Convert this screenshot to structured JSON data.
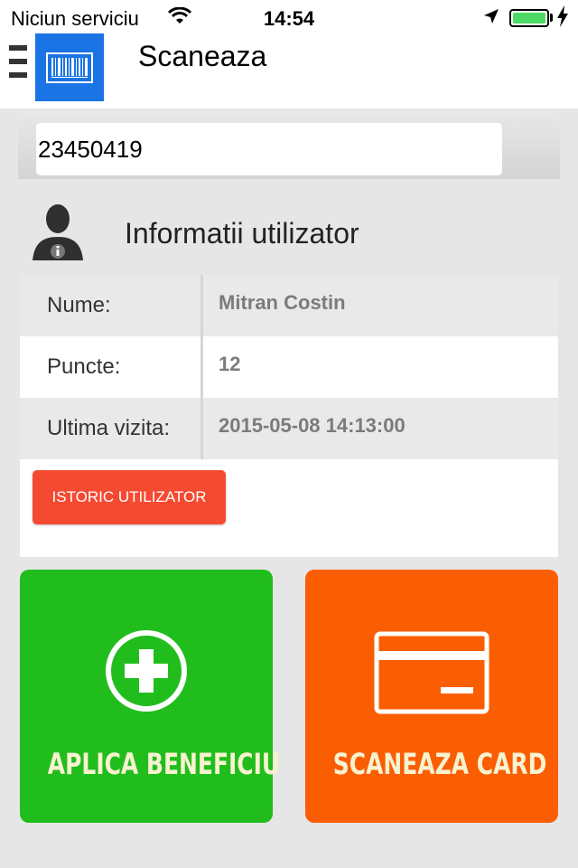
{
  "status": {
    "carrier": "Niciun serviciu",
    "time": "14:54"
  },
  "header": {
    "title": "Scaneaza"
  },
  "search": {
    "value": "23450419"
  },
  "user_info": {
    "title": "Informatii utilizator",
    "rows": [
      {
        "label": "Nume:",
        "value": "Mitran Costin"
      },
      {
        "label": "Puncte:",
        "value": "12"
      },
      {
        "label": "Ultima vizita:",
        "value": "2015-05-08 14:13:00"
      }
    ],
    "history_button": "ISTORIC UTILIZATOR"
  },
  "actions": {
    "apply": "APLICA BENEFICIU",
    "scan": "SCANEAZA CARD"
  },
  "colors": {
    "apply_tile": "#21bd1d",
    "scan_tile": "#fb5d02",
    "history_button": "#f54a32",
    "app_icon": "#1b74e4"
  },
  "icons": {
    "menu": "hamburger-icon",
    "app": "barcode-icon",
    "avatar": "user-info-icon",
    "apply": "plus-circle-icon",
    "scan": "credit-card-icon"
  }
}
